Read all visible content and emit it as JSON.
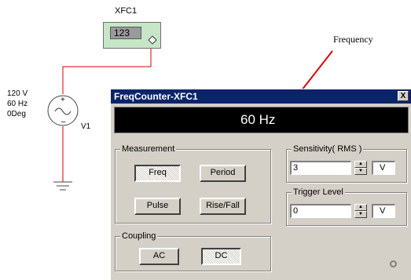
{
  "schematic": {
    "instrument_name": "XFC1",
    "instrument_display": "123",
    "source_label_lines": [
      "120 V",
      "60 Hz",
      "0Deg"
    ],
    "source_name": "V1",
    "annotation": "Frequency",
    "wire_color": "#d40000",
    "annotation_color": "#e00000"
  },
  "window": {
    "title": "FreqCounter-XFC1",
    "close_label": "X",
    "display_value": "60 Hz",
    "measurement": {
      "title": "Measurement",
      "buttons": [
        {
          "label": "Freq",
          "pressed": true
        },
        {
          "label": "Period",
          "pressed": false
        },
        {
          "label": "Pulse",
          "pressed": false
        },
        {
          "label": "Rise/Fall",
          "pressed": false
        }
      ]
    },
    "coupling": {
      "title": "Coupling",
      "buttons": [
        {
          "label": "AC",
          "pressed": false
        },
        {
          "label": "DC",
          "pressed": true
        }
      ]
    },
    "sensitivity": {
      "title": "Sensitivity( RMS )",
      "value": "3",
      "unit": "V"
    },
    "trigger": {
      "title": "Trigger Level",
      "value": "0",
      "unit": "V"
    }
  }
}
